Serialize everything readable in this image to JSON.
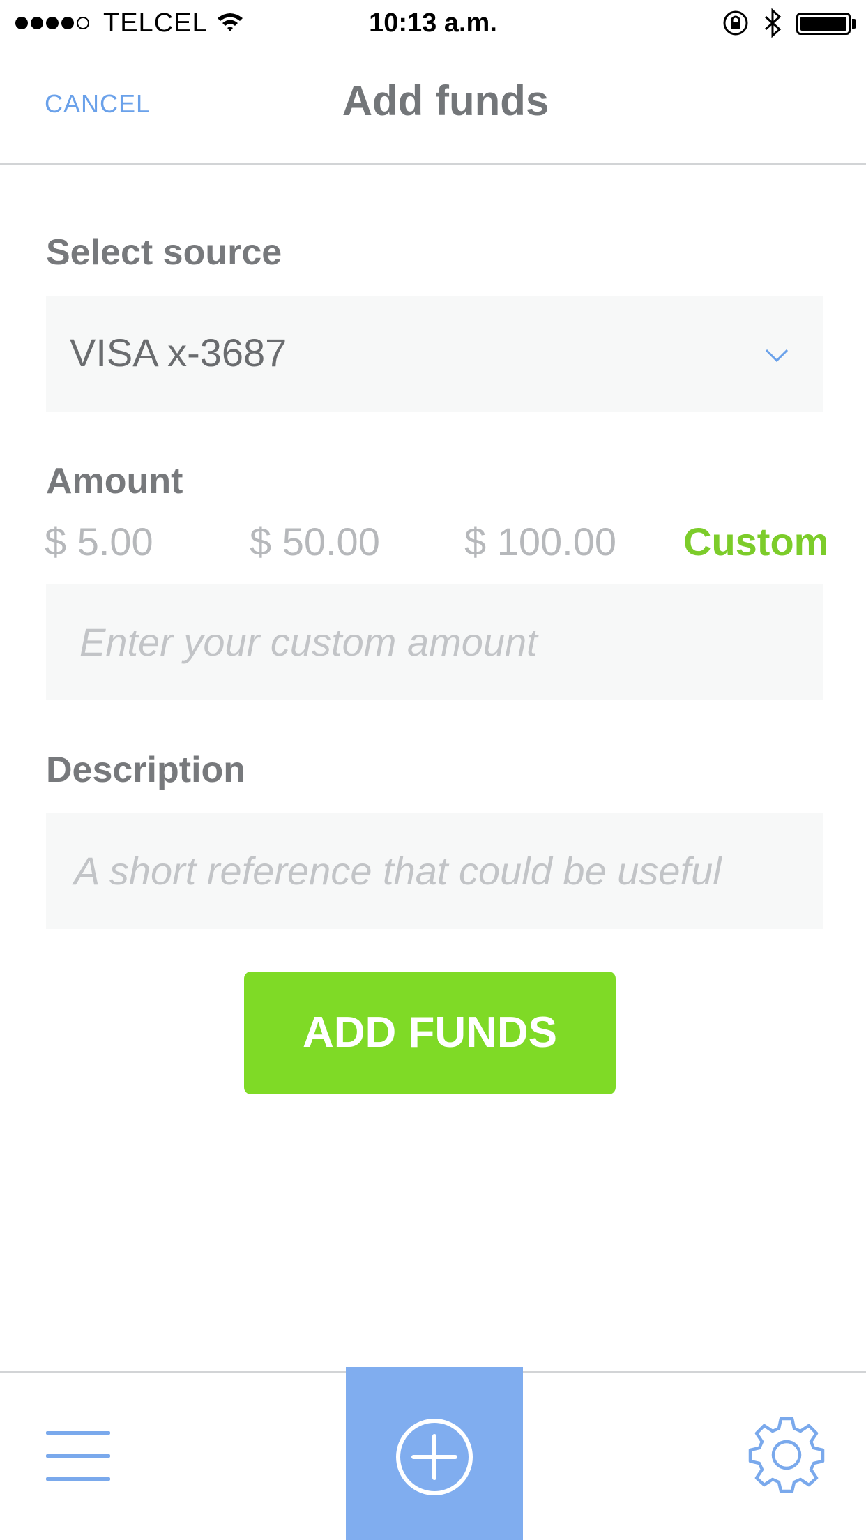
{
  "status_bar": {
    "carrier": "TELCEL",
    "time": "10:13 a.m."
  },
  "nav": {
    "cancel_label": "CANCEL",
    "title": "Add funds"
  },
  "form": {
    "source_label": "Select source",
    "source_value": "VISA x-3687",
    "amount_label": "Amount",
    "amount_options": [
      "$ 5.00",
      "$ 50.00",
      "$ 100.00",
      "Custom"
    ],
    "selected_amount_option": "Custom",
    "custom_amount_placeholder": "Enter your custom amount",
    "description_label": "Description",
    "description_placeholder": "A short reference that could be useful",
    "submit_label": "ADD FUNDS"
  },
  "tab_bar": {
    "left_icon": "menu-icon",
    "center_icon": "plus-circle-icon",
    "right_icon": "gear-icon"
  },
  "colors": {
    "accent_blue": "#6aa1ea",
    "tab_blue": "#80adef",
    "accent_green": "#7fda26",
    "custom_green": "#7ccc2a",
    "field_bg": "#f7f8f8"
  }
}
